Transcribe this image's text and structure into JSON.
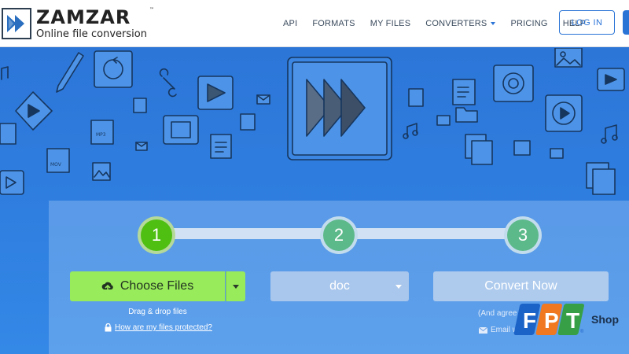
{
  "header": {
    "brand": "ZAMZAR",
    "brand_tm": "™",
    "tagline": "Online file conversion",
    "nav": [
      {
        "label": "API"
      },
      {
        "label": "FORMATS"
      },
      {
        "label": "MY FILES"
      },
      {
        "label": "CONVERTERS",
        "has_dropdown": true
      },
      {
        "label": "PRICING"
      },
      {
        "label": "HELP"
      }
    ],
    "login_label": "LOG IN"
  },
  "steps": [
    {
      "number": "1",
      "state": "active"
    },
    {
      "number": "2",
      "state": "inactive"
    },
    {
      "number": "3",
      "state": "inactive"
    }
  ],
  "upload": {
    "choose_label": "Choose Files",
    "drag_text": "Drag & drop files",
    "protect_link": "How are my files protected?"
  },
  "format": {
    "selected": "doc"
  },
  "convert": {
    "label": "Convert Now",
    "agree_text": "(And agree",
    "email_text": "Email when"
  },
  "watermark": {
    "letters": [
      "F",
      "P",
      "T"
    ],
    "shop": "Shop",
    "registered": "®"
  },
  "colors": {
    "brand_blue": "#2a74d6",
    "step_active": "#4fbf12",
    "choose_button": "#98eb5a",
    "fpt_blue": "#1c63c8",
    "fpt_orange": "#f07820",
    "fpt_green": "#37a047"
  },
  "icons": {
    "logo": "zamzar-play-arrows-icon",
    "hero": "fast-forward-arrows-icon",
    "upload": "upload-cloud-icon",
    "lock": "lock-icon",
    "email": "envelope-icon"
  }
}
